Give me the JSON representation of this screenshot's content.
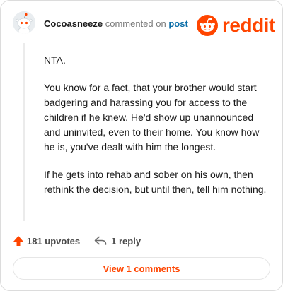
{
  "header": {
    "username": "Cocoasneeze",
    "action_text": "commented on",
    "target": "post"
  },
  "logo": {
    "wordmark": "reddit",
    "color": "#ff4500"
  },
  "comment": {
    "paragraphs": [
      "NTA.",
      "You know for a fact, that your brother would start badgering and harassing you for access to the children if he knew. He'd show up unannounced and uninvited, even to their home. You know how he is, you've dealt with him the longest.",
      "If he gets into rehab and sober on his own, then rethink the decision, but until then, tell him nothing."
    ]
  },
  "actions": {
    "upvotes_label": "181 upvotes",
    "reply_label": "1 reply",
    "upvote_icon": "arrow-up-icon",
    "reply_icon": "reply-arrow-icon"
  },
  "footer": {
    "view_label": "View 1 comments"
  }
}
